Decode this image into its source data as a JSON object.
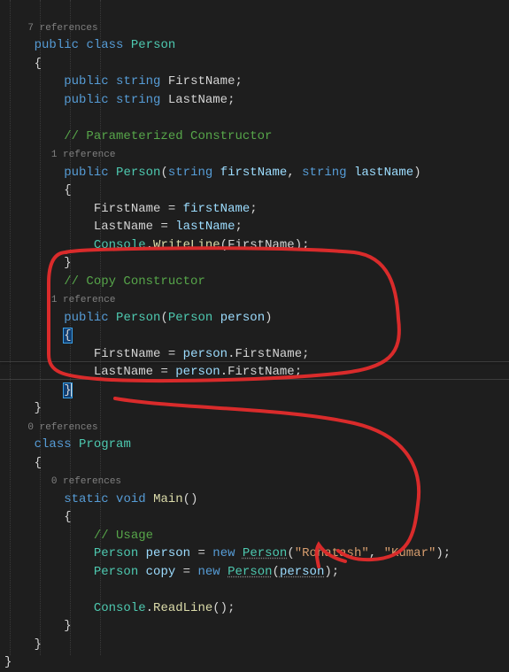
{
  "editor": {
    "theme": "vs-dark",
    "language": "csharp"
  },
  "refs": {
    "r7": "7 references",
    "r1a": "1 reference",
    "r1b": "1 reference",
    "r0a": "0 references",
    "r0b": "0 references"
  },
  "kw": {
    "public": "public",
    "class": "class",
    "string": "string",
    "void": "void",
    "static": "static",
    "new": "new"
  },
  "types": {
    "Person": "Person",
    "Program": "Program",
    "Console": "Console"
  },
  "fields": {
    "FirstName": "FirstName",
    "LastName": "LastName"
  },
  "params": {
    "firstName": "firstName",
    "lastName": "lastName",
    "person": "person",
    "copy": "copy"
  },
  "methods": {
    "WriteLine": "WriteLine",
    "Main": "Main",
    "ReadLine": "ReadLine"
  },
  "comments": {
    "paramCtor": "// Parameterized Constructor",
    "copyCtor": "// Copy Constructor",
    "usage": "// Usage"
  },
  "strings": {
    "rohatash": "\"Rohatash\"",
    "kumar": "\"Kumar\""
  },
  "punct": {
    "obrace": "{",
    "cbrace": "}",
    "oparen": "(",
    "cparen": ")",
    "semi": ";",
    "comma": ",",
    "dot": ".",
    "eq": "=",
    "sp": " "
  }
}
